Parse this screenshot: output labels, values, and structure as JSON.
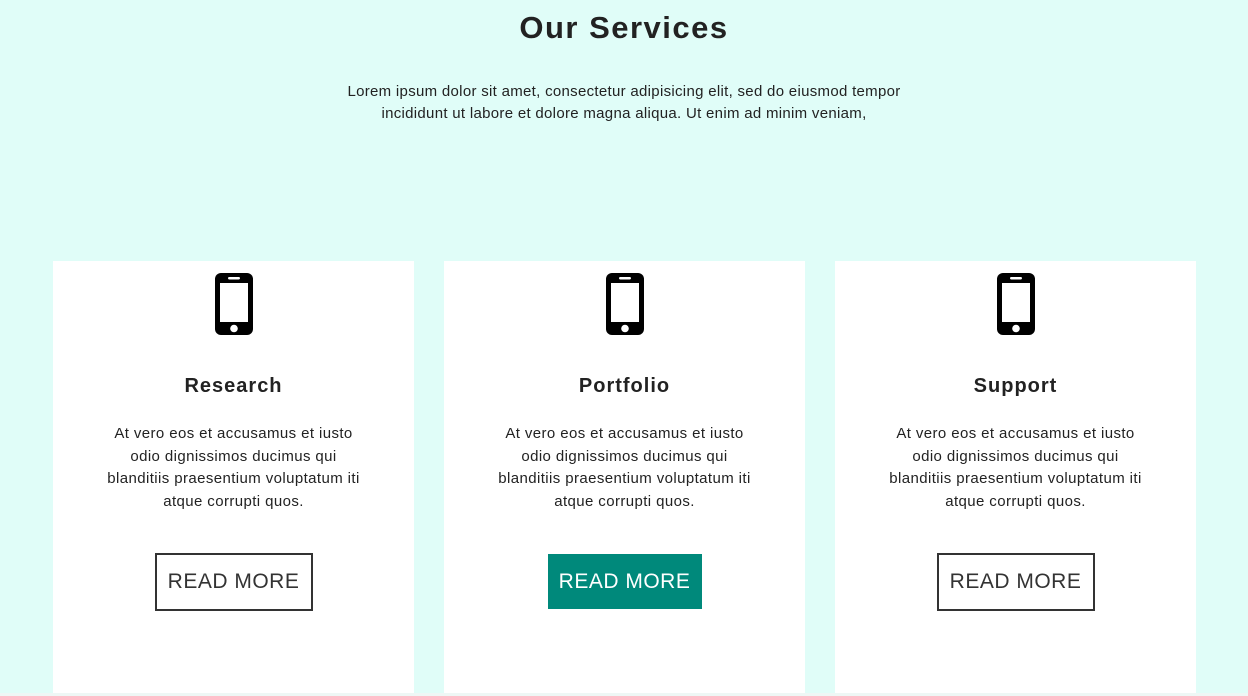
{
  "header": {
    "title": "Our Services",
    "intro": "Lorem ipsum dolor sit amet, consectetur adipisicing elit, sed do eiusmod tempor incididunt ut labore et dolore magna aliqua. Ut enim ad minim veniam,"
  },
  "cards": [
    {
      "icon": "smartphone-icon",
      "title": "Research",
      "text": "At vero eos et accusamus et iusto odio dignissimos ducimus qui blanditiis praesentium voluptatum iti atque corrupti quos.",
      "button_label": "READ MORE",
      "button_state": "default"
    },
    {
      "icon": "smartphone-icon",
      "title": "Portfolio",
      "text": "At vero eos et accusamus et iusto odio dignissimos ducimus qui blanditiis praesentium voluptatum iti atque corrupti quos.",
      "button_label": "READ MORE",
      "button_state": "active"
    },
    {
      "icon": "smartphone-icon",
      "title": "Support",
      "text": "At vero eos et accusamus et iusto odio dignissimos ducimus qui blanditiis praesentium voluptatum iti atque corrupti quos.",
      "button_label": "READ MORE",
      "button_state": "default"
    }
  ],
  "colors": {
    "background": "#e0fdf8",
    "card_background": "#ffffff",
    "accent": "#00897b",
    "text": "#222222"
  }
}
